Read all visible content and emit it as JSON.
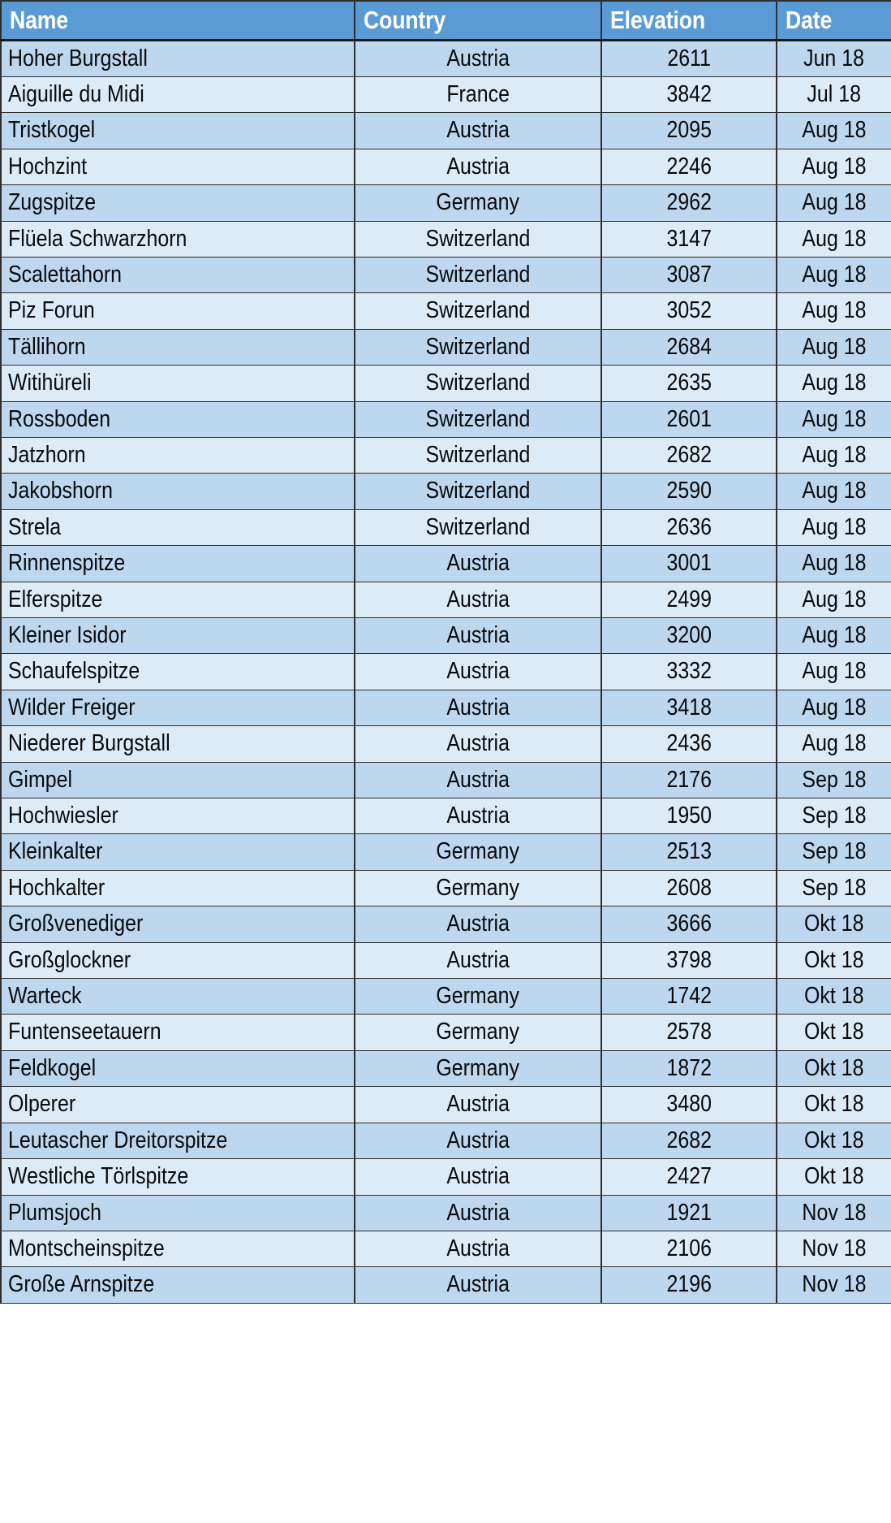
{
  "table": {
    "headers": [
      {
        "key": "name",
        "label": "Name",
        "align": "left"
      },
      {
        "key": "country",
        "label": "Country",
        "align": "center"
      },
      {
        "key": "elevation",
        "label": "Elevation",
        "align": "center"
      },
      {
        "key": "date",
        "label": "Date",
        "align": "center"
      }
    ],
    "colors": {
      "header_background": "#5B9BD5",
      "header_text": "#FFFFFF",
      "row_band_dark": "#BDD7EE",
      "row_band_light": "#DDEBF7",
      "grid_line": "#2E2E2E",
      "body_text": "#0A0A0A"
    },
    "rows": [
      {
        "name": "Hoher Burgstall",
        "country": "Austria",
        "elevation": "2611",
        "date": "Jun 18"
      },
      {
        "name": "Aiguille du Midi",
        "country": "France",
        "elevation": "3842",
        "date": "Jul 18"
      },
      {
        "name": "Tristkogel",
        "country": "Austria",
        "elevation": "2095",
        "date": "Aug 18"
      },
      {
        "name": "Hochzint",
        "country": "Austria",
        "elevation": "2246",
        "date": "Aug 18"
      },
      {
        "name": "Zugspitze",
        "country": "Germany",
        "elevation": "2962",
        "date": "Aug 18"
      },
      {
        "name": "Flüela Schwarzhorn",
        "country": "Switzerland",
        "elevation": "3147",
        "date": "Aug 18"
      },
      {
        "name": "Scalettahorn",
        "country": "Switzerland",
        "elevation": "3087",
        "date": "Aug 18"
      },
      {
        "name": "Piz Forun",
        "country": "Switzerland",
        "elevation": "3052",
        "date": "Aug 18"
      },
      {
        "name": "Tällihorn",
        "country": "Switzerland",
        "elevation": "2684",
        "date": "Aug 18"
      },
      {
        "name": "Witihüreli",
        "country": "Switzerland",
        "elevation": "2635",
        "date": "Aug 18"
      },
      {
        "name": "Rossboden",
        "country": "Switzerland",
        "elevation": "2601",
        "date": "Aug 18"
      },
      {
        "name": "Jatzhorn",
        "country": "Switzerland",
        "elevation": "2682",
        "date": "Aug 18"
      },
      {
        "name": "Jakobshorn",
        "country": "Switzerland",
        "elevation": "2590",
        "date": "Aug 18"
      },
      {
        "name": "Strela",
        "country": "Switzerland",
        "elevation": "2636",
        "date": "Aug 18"
      },
      {
        "name": "Rinnenspitze",
        "country": "Austria",
        "elevation": "3001",
        "date": "Aug 18"
      },
      {
        "name": "Elferspitze",
        "country": "Austria",
        "elevation": "2499",
        "date": "Aug 18"
      },
      {
        "name": "Kleiner Isidor",
        "country": "Austria",
        "elevation": "3200",
        "date": "Aug 18"
      },
      {
        "name": "Schaufelspitze",
        "country": "Austria",
        "elevation": "3332",
        "date": "Aug 18"
      },
      {
        "name": "Wilder Freiger",
        "country": "Austria",
        "elevation": "3418",
        "date": "Aug 18"
      },
      {
        "name": "Niederer Burgstall",
        "country": "Austria",
        "elevation": "2436",
        "date": "Aug 18"
      },
      {
        "name": "Gimpel",
        "country": "Austria",
        "elevation": "2176",
        "date": "Sep 18"
      },
      {
        "name": "Hochwiesler",
        "country": "Austria",
        "elevation": "1950",
        "date": "Sep 18"
      },
      {
        "name": "Kleinkalter",
        "country": "Germany",
        "elevation": "2513",
        "date": "Sep 18"
      },
      {
        "name": "Hochkalter",
        "country": "Germany",
        "elevation": "2608",
        "date": "Sep 18"
      },
      {
        "name": "Großvenediger",
        "country": "Austria",
        "elevation": "3666",
        "date": "Okt 18"
      },
      {
        "name": "Großglockner",
        "country": "Austria",
        "elevation": "3798",
        "date": "Okt 18"
      },
      {
        "name": "Warteck",
        "country": "Germany",
        "elevation": "1742",
        "date": "Okt 18"
      },
      {
        "name": "Funtenseetauern",
        "country": "Germany",
        "elevation": "2578",
        "date": "Okt 18"
      },
      {
        "name": "Feldkogel",
        "country": "Germany",
        "elevation": "1872",
        "date": "Okt 18"
      },
      {
        "name": "Olperer",
        "country": "Austria",
        "elevation": "3480",
        "date": "Okt 18"
      },
      {
        "name": "Leutascher Dreitorspitze",
        "country": "Austria",
        "elevation": "2682",
        "date": "Okt 18"
      },
      {
        "name": "Westliche Törlspitze",
        "country": "Austria",
        "elevation": "2427",
        "date": "Okt 18"
      },
      {
        "name": "Plumsjoch",
        "country": "Austria",
        "elevation": "1921",
        "date": "Nov 18"
      },
      {
        "name": "Montscheinspitze",
        "country": "Austria",
        "elevation": "2106",
        "date": "Nov 18"
      },
      {
        "name": "Große Arnspitze",
        "country": "Austria",
        "elevation": "2196",
        "date": "Nov 18"
      }
    ]
  }
}
